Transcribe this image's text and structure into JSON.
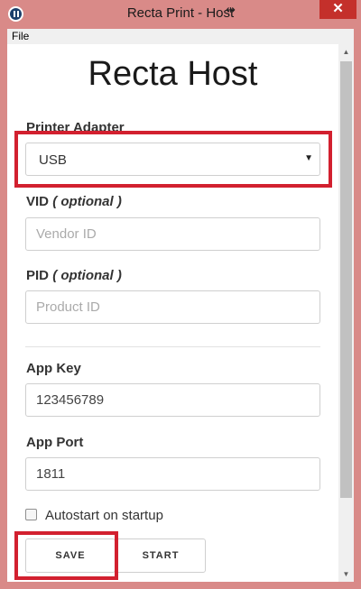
{
  "window": {
    "title": "Recta Print - Host",
    "close_glyph": "✕",
    "resize_glyph": "⇹",
    "frame_color": "#d98a88",
    "close_color": "#c4302b"
  },
  "menu": {
    "items": [
      "File"
    ]
  },
  "app": {
    "heading": "Recta Host"
  },
  "printer_adapter": {
    "label": "Printer Adapter",
    "selected": "USB",
    "caret_icon": "caret-down-icon"
  },
  "vid": {
    "label": "VID",
    "optional": "( optional )",
    "value": "",
    "placeholder": "Vendor ID"
  },
  "pid": {
    "label": "PID",
    "optional": "( optional )",
    "value": "",
    "placeholder": "Product ID"
  },
  "app_key": {
    "label": "App Key",
    "value": "123456789",
    "placeholder": ""
  },
  "app_port": {
    "label": "App Port",
    "value": "1811",
    "placeholder": ""
  },
  "autostart": {
    "label": "Autostart on startup",
    "checked": false
  },
  "buttons": {
    "save": "SAVE",
    "start": "START"
  },
  "annotations": {
    "highlight_color": "#d2202f"
  }
}
